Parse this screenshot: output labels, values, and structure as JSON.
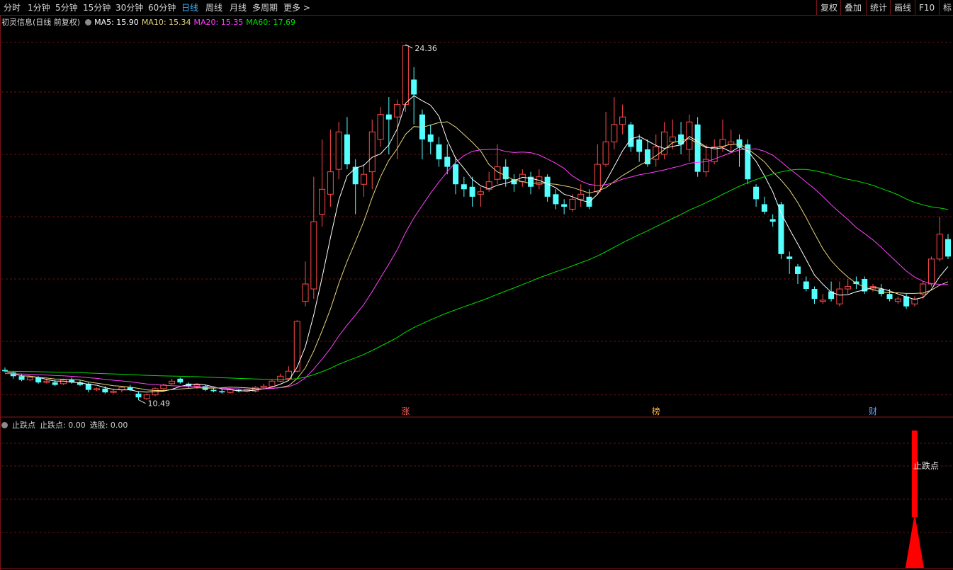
{
  "toolbar": {
    "periods": [
      "分时",
      "1分钟",
      "5分钟",
      "15分钟",
      "30分钟",
      "60分钟",
      "日线",
      "周线",
      "月线",
      "多周期",
      "更多 >"
    ],
    "active_period": "日线",
    "right_buttons": [
      "复权",
      "叠加",
      "统计",
      "画线",
      "F10",
      "标"
    ]
  },
  "legend": {
    "title": "初灵信息(日线 前复权)",
    "ma5": "MA5: 15.90",
    "ma10": "MA10: 15.34",
    "ma20": "MA20: 15.35",
    "ma60": "MA60: 17.69"
  },
  "sub_legend": {
    "indicator": "止跌点",
    "value1": "止跌点: 0.00",
    "value2": "选股: 0.00"
  },
  "colors": {
    "up": "#ff4a4a",
    "down": "#54ffff",
    "ma5": "#ffffff",
    "ma10": "#e6d47a",
    "ma20": "#ff40ff",
    "ma60": "#00e000",
    "grid": "#6a1010",
    "signal": "#ff0000"
  },
  "chart_data": {
    "type": "candlestick",
    "price_range": [
      10.0,
      25.0
    ],
    "high_label": "24.36",
    "low_label": "10.49",
    "markers": [
      "涨",
      "榜",
      "财"
    ],
    "signal_label": "止跌点",
    "candles": [
      [
        11.35,
        11.3,
        11.45,
        11.25
      ],
      [
        11.25,
        11.1,
        11.3,
        11.0
      ],
      [
        11.1,
        10.95,
        11.2,
        10.9
      ],
      [
        10.95,
        11.05,
        11.1,
        10.9
      ],
      [
        11.05,
        10.85,
        11.1,
        10.8
      ],
      [
        10.85,
        10.9,
        11.0,
        10.8
      ],
      [
        10.85,
        10.75,
        10.95,
        10.7
      ],
      [
        10.8,
        10.95,
        11.0,
        10.75
      ],
      [
        10.95,
        10.85,
        11.05,
        10.8
      ],
      [
        10.85,
        10.75,
        10.95,
        10.7
      ],
      [
        10.8,
        10.55,
        10.85,
        10.45
      ],
      [
        10.55,
        10.6,
        10.65,
        10.5
      ],
      [
        10.6,
        10.45,
        10.7,
        10.4
      ],
      [
        10.45,
        10.5,
        10.6,
        10.4
      ],
      [
        10.55,
        10.65,
        10.7,
        10.45
      ],
      [
        10.65,
        10.55,
        10.75,
        10.5
      ],
      [
        10.4,
        10.25,
        10.5,
        10.15
      ],
      [
        10.2,
        10.35,
        10.4,
        10.15
      ],
      [
        10.35,
        10.6,
        10.65,
        10.3
      ],
      [
        10.6,
        10.75,
        10.8,
        10.55
      ],
      [
        10.8,
        10.9,
        11.0,
        10.75
      ],
      [
        11.0,
        10.85,
        11.05,
        10.8
      ],
      [
        10.8,
        10.7,
        10.85,
        10.6
      ],
      [
        10.7,
        10.75,
        10.8,
        10.6
      ],
      [
        10.7,
        10.55,
        10.75,
        10.5
      ],
      [
        10.55,
        10.5,
        10.65,
        10.45
      ],
      [
        10.5,
        10.45,
        10.6,
        10.4
      ],
      [
        10.45,
        10.55,
        10.6,
        10.4
      ],
      [
        10.55,
        10.5,
        10.6,
        10.45
      ],
      [
        10.5,
        10.55,
        10.6,
        10.45
      ],
      [
        10.5,
        10.65,
        10.7,
        10.45
      ],
      [
        10.65,
        10.7,
        10.8,
        10.6
      ],
      [
        10.7,
        10.9,
        10.95,
        10.65
      ],
      [
        10.9,
        11.1,
        11.2,
        10.85
      ],
      [
        11.0,
        11.3,
        11.5,
        10.95
      ],
      [
        11.3,
        13.3,
        13.35,
        11.25
      ],
      [
        14.1,
        14.8,
        15.7,
        13.9
      ],
      [
        14.6,
        17.3,
        19.1,
        14.2
      ],
      [
        17.6,
        18.6,
        20.6,
        17.1
      ],
      [
        18.4,
        19.3,
        21.0,
        17.9
      ],
      [
        19.4,
        20.9,
        21.3,
        19.0
      ],
      [
        20.8,
        19.6,
        21.5,
        19.4
      ],
      [
        19.5,
        18.8,
        19.8,
        17.6
      ],
      [
        18.8,
        19.2,
        19.6,
        18.3
      ],
      [
        19.3,
        20.9,
        21.4,
        18.6
      ],
      [
        20.6,
        21.6,
        21.9,
        20.3
      ],
      [
        21.6,
        21.4,
        22.3,
        20.0
      ],
      [
        21.5,
        22.0,
        22.2,
        19.8
      ],
      [
        22.0,
        24.36,
        24.4,
        21.7
      ],
      [
        23.0,
        22.4,
        23.5,
        21.2
      ],
      [
        21.6,
        20.6,
        21.8,
        19.8
      ],
      [
        20.8,
        20.5,
        21.2,
        20.0
      ],
      [
        20.4,
        19.8,
        20.7,
        19.5
      ],
      [
        19.9,
        19.5,
        20.4,
        19.2
      ],
      [
        19.6,
        18.8,
        19.9,
        18.4
      ],
      [
        18.8,
        18.6,
        19.1,
        18.3
      ],
      [
        18.7,
        18.3,
        19.1,
        17.9
      ],
      [
        18.4,
        18.5,
        18.7,
        17.9
      ],
      [
        18.6,
        18.9,
        19.3,
        18.5
      ],
      [
        19.0,
        19.5,
        20.4,
        18.8
      ],
      [
        19.5,
        19.0,
        19.8,
        18.7
      ],
      [
        19.0,
        18.8,
        19.2,
        18.5
      ],
      [
        18.9,
        19.2,
        19.4,
        18.7
      ],
      [
        19.1,
        18.7,
        19.3,
        18.4
      ],
      [
        18.8,
        19.1,
        19.4,
        18.6
      ],
      [
        19.1,
        18.3,
        19.2,
        18.1
      ],
      [
        18.4,
        18.0,
        18.6,
        17.8
      ],
      [
        18.0,
        17.9,
        18.2,
        17.6
      ],
      [
        17.8,
        18.2,
        18.4,
        17.7
      ],
      [
        18.2,
        18.4,
        18.8,
        17.9
      ],
      [
        18.3,
        17.9,
        18.6,
        17.8
      ],
      [
        18.5,
        19.6,
        20.4,
        18.4
      ],
      [
        19.6,
        20.5,
        21.7,
        19.5
      ],
      [
        20.5,
        21.2,
        22.3,
        20.2
      ],
      [
        21.2,
        21.5,
        22.0,
        20.8
      ],
      [
        21.2,
        20.3,
        21.3,
        20.1
      ],
      [
        20.6,
        20.1,
        20.8,
        19.7
      ],
      [
        20.2,
        19.6,
        20.6,
        19.5
      ],
      [
        19.8,
        20.3,
        20.8,
        19.5
      ],
      [
        20.0,
        20.9,
        21.3,
        19.8
      ],
      [
        20.5,
        20.7,
        21.4,
        20.2
      ],
      [
        20.8,
        20.4,
        21.3,
        20.0
      ],
      [
        20.2,
        21.3,
        21.6,
        19.7
      ],
      [
        21.2,
        19.3,
        21.5,
        19.1
      ],
      [
        19.3,
        19.8,
        20.4,
        19.1
      ],
      [
        19.7,
        20.3,
        20.6,
        19.6
      ],
      [
        20.3,
        20.6,
        21.4,
        20.1
      ],
      [
        20.4,
        20.5,
        21.0,
        20.1
      ],
      [
        20.6,
        20.3,
        20.8,
        19.5
      ],
      [
        20.4,
        19.0,
        20.6,
        18.8
      ],
      [
        18.7,
        18.2,
        18.8,
        17.9
      ],
      [
        18.0,
        17.7,
        18.3,
        17.6
      ],
      [
        17.4,
        17.3,
        17.6,
        17.1
      ],
      [
        18.0,
        16.0,
        18.1,
        15.8
      ],
      [
        15.9,
        15.8,
        16.1,
        15.2
      ],
      [
        15.5,
        15.2,
        15.6,
        14.8
      ],
      [
        14.9,
        14.6,
        15.1,
        14.5
      ],
      [
        14.6,
        14.2,
        14.7,
        14.0
      ],
      [
        14.1,
        14.15,
        14.4,
        14.0
      ],
      [
        14.5,
        14.2,
        14.9,
        14.1
      ],
      [
        14.0,
        14.6,
        14.9,
        13.9
      ],
      [
        14.6,
        14.7,
        15.0,
        14.4
      ],
      [
        14.9,
        14.8,
        15.1,
        14.6
      ],
      [
        15.0,
        14.5,
        15.1,
        14.4
      ],
      [
        14.6,
        14.7,
        14.8,
        14.5
      ],
      [
        14.6,
        14.4,
        14.8,
        14.3
      ],
      [
        14.4,
        14.2,
        14.6,
        14.1
      ],
      [
        14.1,
        14.2,
        14.3,
        14.0
      ],
      [
        14.3,
        13.9,
        14.4,
        13.8
      ],
      [
        14.0,
        14.2,
        14.3,
        13.9
      ],
      [
        14.4,
        14.8,
        14.9,
        14.2
      ],
      [
        14.8,
        15.8,
        15.9,
        14.7
      ],
      [
        15.8,
        16.8,
        17.5,
        15.7
      ],
      [
        16.6,
        15.9,
        16.8,
        15.8
      ]
    ],
    "signal_index": 109
  }
}
